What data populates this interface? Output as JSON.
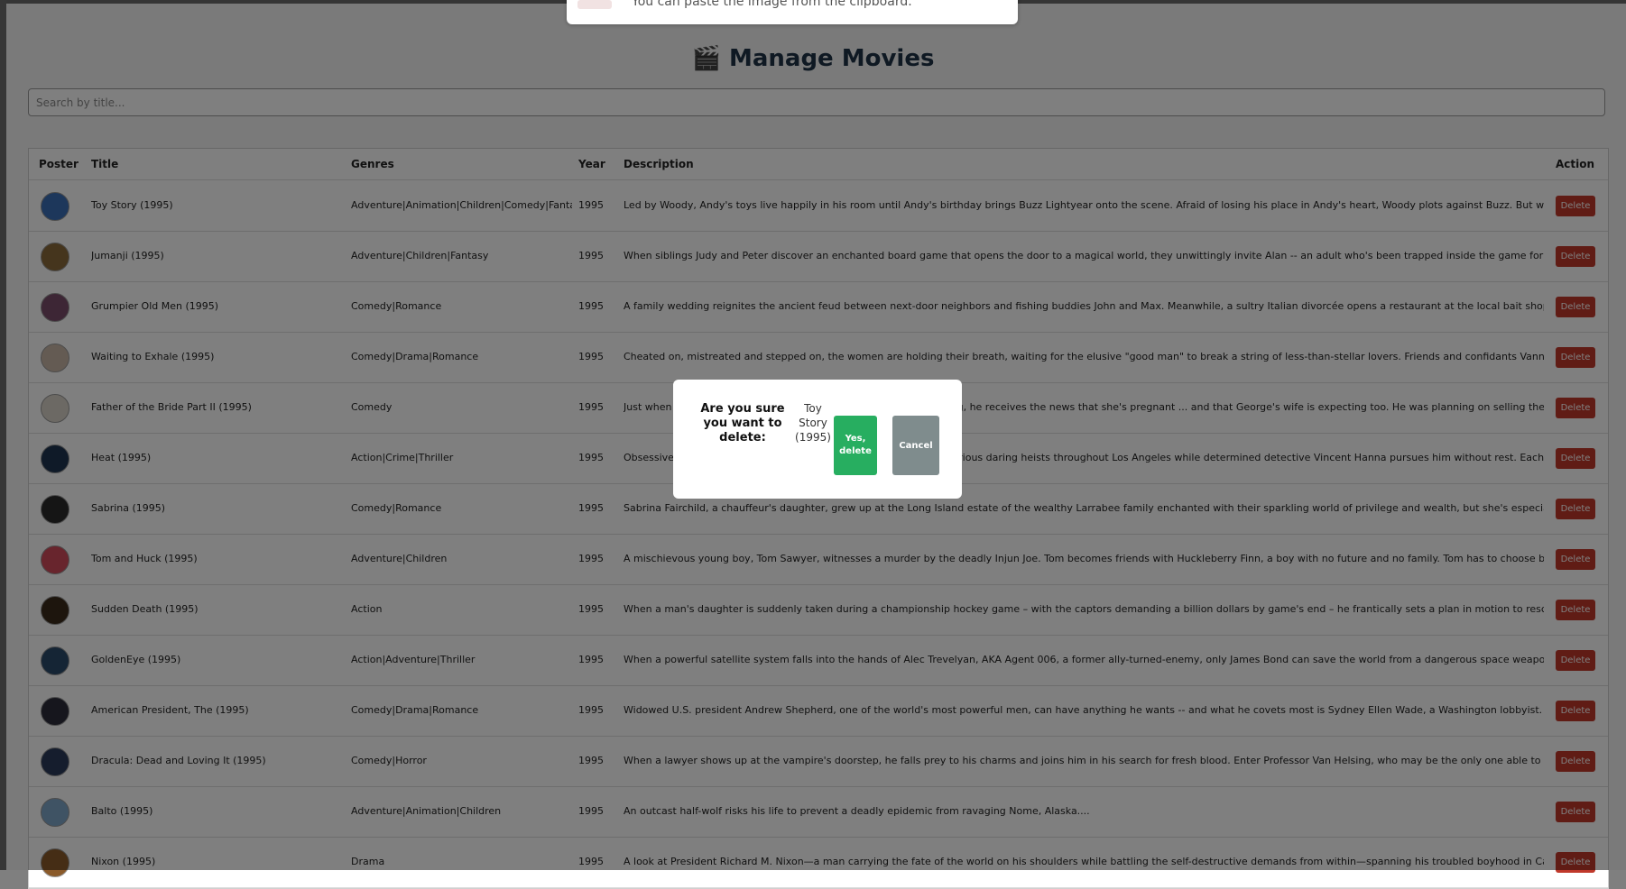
{
  "toast": {
    "text": "You can paste the image from the clipboard."
  },
  "page_title": "🎬 Manage Movies",
  "search": {
    "placeholder": "Search by title...",
    "value": ""
  },
  "table": {
    "headers": {
      "poster": "Poster",
      "title": "Title",
      "genres": "Genres",
      "year": "Year",
      "description": "Description",
      "action": "Action"
    },
    "rows": [
      {
        "title": "Toy Story (1995)",
        "genres": "Adventure|Animation|Children|Comedy|Fantasy",
        "year": "1995",
        "description": "Led by Woody, Andy's toys live happily in his room until Andy's birthday brings Buzz Lightyear onto the scene. Afraid of losing his place in Andy's heart, Woody plots against Buzz. But when circumstan...",
        "action": "Delete",
        "poster_color": "#3b6fb6"
      },
      {
        "title": "Jumanji (1995)",
        "genres": "Adventure|Children|Fantasy",
        "year": "1995",
        "description": "When siblings Judy and Peter discover an enchanted board game that opens the door to a magical world, they unwittingly invite Alan -- an adult who's been trapped inside the game for 26 years -- into t...",
        "action": "Delete",
        "poster_color": "#8a6a3a"
      },
      {
        "title": "Grumpier Old Men (1995)",
        "genres": "Comedy|Romance",
        "year": "1995",
        "description": "A family wedding reignites the ancient feud between next-door neighbors and fishing buddies John and Max. Meanwhile, a sultry Italian divorcée opens a restaurant at the local bait shop, alarming the l...",
        "action": "Delete",
        "poster_color": "#7a4d6b"
      },
      {
        "title": "Waiting to Exhale (1995)",
        "genres": "Comedy|Drama|Romance",
        "year": "1995",
        "description": "Cheated on, mistreated and stepped on, the women are holding their breath, waiting for the elusive \"good man\" to break a string of less-than-stellar lovers. Friends and confidants Vannah, Bernie, Glo ...",
        "action": "Delete",
        "poster_color": "#c9b7a6"
      },
      {
        "title": "Father of the Bride Part II (1995)",
        "genres": "Comedy",
        "year": "1995",
        "description": "Just when George Banks has recovered from his daughter's wedding, he receives the news that she's pregnant ... and that George's wife is expecting too. He was planning on selling their home, but that'...",
        "action": "Delete",
        "poster_color": "#d9d2c8"
      },
      {
        "title": "Heat (1995)",
        "genres": "Action|Crime|Thriller",
        "year": "1995",
        "description": "Obsessive master thief Neil McCauley leads a top-notch crew on various daring heists throughout Los Angeles while determined detective Vincent Hanna pursues him without rest. Each man recognizes and r...",
        "action": "Delete",
        "poster_color": "#1f3550"
      },
      {
        "title": "Sabrina (1995)",
        "genres": "Comedy|Romance",
        "year": "1995",
        "description": "Sabrina Fairchild, a chauffeur's daughter, grew up at the Long Island estate of the wealthy Larrabee family enchanted with their sparkling world of privilege and wealth, but she's especially enamored ...",
        "action": "Delete",
        "poster_color": "#2a2a2a"
      },
      {
        "title": "Tom and Huck (1995)",
        "genres": "Adventure|Children",
        "year": "1995",
        "description": "A mischievous young boy, Tom Sawyer, witnesses a murder by the deadly Injun Joe. Tom becomes friends with Huckleberry Finn, a boy with no future and no family. Tom has to choose between honoring a fri...",
        "action": "Delete",
        "poster_color": "#d04a5a"
      },
      {
        "title": "Sudden Death (1995)",
        "genres": "Action",
        "year": "1995",
        "description": "When a man's daughter is suddenly taken during a championship hockey game – with the captors demanding a billion dollars by game's end – he frantically sets a plan in motion to rescue her and abort an...",
        "action": "Delete",
        "poster_color": "#3a2a1a"
      },
      {
        "title": "GoldenEye (1995)",
        "genres": "Action|Adventure|Thriller",
        "year": "1995",
        "description": "When a powerful satellite system falls into the hands of Alec Trevelyan, AKA Agent 006, a former ally-turned-enemy, only James Bond can save the world from a dangerous space weapon that -- in one shor...",
        "action": "Delete",
        "poster_color": "#2b4a6a"
      },
      {
        "title": "American President, The (1995)",
        "genres": "Comedy|Drama|Romance",
        "year": "1995",
        "description": "Widowed U.S. president Andrew Shepherd, one of the world's most powerful men, can have anything he wants -- and what he covets most is Sydney Ellen Wade, a Washington lobbyist. But Shepherd's attempts...",
        "action": "Delete",
        "poster_color": "#2c2c3a"
      },
      {
        "title": "Dracula: Dead and Loving It (1995)",
        "genres": "Comedy|Horror",
        "year": "1995",
        "description": "When a lawyer shows up at the vampire's doorstep, he falls prey to his charms and joins him in his search for fresh blood. Enter Professor Van Helsing, who may be the only one able to vanquish the Cou...",
        "action": "Delete",
        "poster_color": "#2a3a5a"
      },
      {
        "title": "Balto (1995)",
        "genres": "Adventure|Animation|Children",
        "year": "1995",
        "description": "An outcast half-wolf risks his life to prevent a deadly epidemic from ravaging Nome, Alaska....",
        "action": "Delete",
        "poster_color": "#7fa6c9"
      },
      {
        "title": "Nixon (1995)",
        "genres": "Drama",
        "year": "1995",
        "description": "A look at President Richard M. Nixon—a man carrying the fate of the world on his shoulders while battling the self-destructive demands from within—spanning his troubled boyhood in California to the sh...",
        "action": "Delete",
        "poster_color": "#8a5a2a"
      }
    ]
  },
  "modal": {
    "question": "Are you sure you want to delete:",
    "movie": "Toy Story (1995)",
    "confirm_label": "Yes, delete",
    "cancel_label": "Cancel"
  },
  "colors": {
    "danger": "#c0392b",
    "confirm": "#27ae60",
    "cancel": "#7f8c8d",
    "title": "#1f3347"
  }
}
